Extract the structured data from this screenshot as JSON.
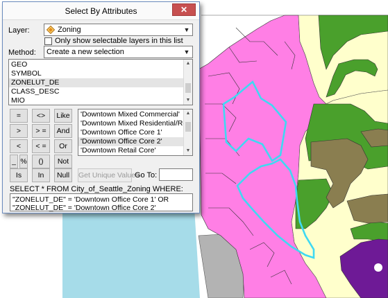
{
  "colors": {
    "water": "#a6dce9",
    "downtown_magenta": "#ff7fe5",
    "residential_yellow": "#ffffcc",
    "green": "#4aa02c",
    "olive": "#8a7e50",
    "purple": "#6e1a96",
    "gray": "#b3b3b3",
    "selection_cyan": "#3fd9f2"
  },
  "dialog": {
    "title": "Select By Attributes",
    "close_label": "✕",
    "layer_label": "Layer:",
    "layer_value": "Zoning",
    "layer_icon": "diamond-layer-icon",
    "only_selectable_label": "Only show selectable layers in this list",
    "method_label": "Method:",
    "method_value": "Create a new selection",
    "fields": [
      "GEO",
      "SYMBOL",
      "ZONELUT_DE",
      "CLASS_DESC",
      "MIO"
    ],
    "selected_field": "ZONELUT_DE",
    "operators": {
      "eq": "=",
      "ne": "<>",
      "like": "Like",
      "gt": ">",
      "ge": "> =",
      "and": "And",
      "lt": "<",
      "le": "< =",
      "or": "Or",
      "underscore": "_",
      "percent": "%",
      "parens": "()",
      "not": "Not",
      "is": "Is",
      "in": "In",
      "null": "Null"
    },
    "values": [
      "'Downtown Mixed Commercial'",
      "'Downtown Mixed Residential/Residential'",
      "'Downtown Office Core 1'",
      "'Downtown Office Core 2'",
      "'Downtown Retail Core'"
    ],
    "selected_value": "'Downtown Office Core 2'",
    "get_unique_label": "Get Unique Values",
    "goto_label": "Go To:",
    "goto_value": "",
    "sql_prefix": "SELECT * FROM City_of_Seattle_Zoning WHERE:",
    "sql_expression": "\"ZONELUT_DE\" = 'Downtown Office Core 1' OR \"ZONELUT_DE\" = 'Downtown Office Core 2'"
  }
}
